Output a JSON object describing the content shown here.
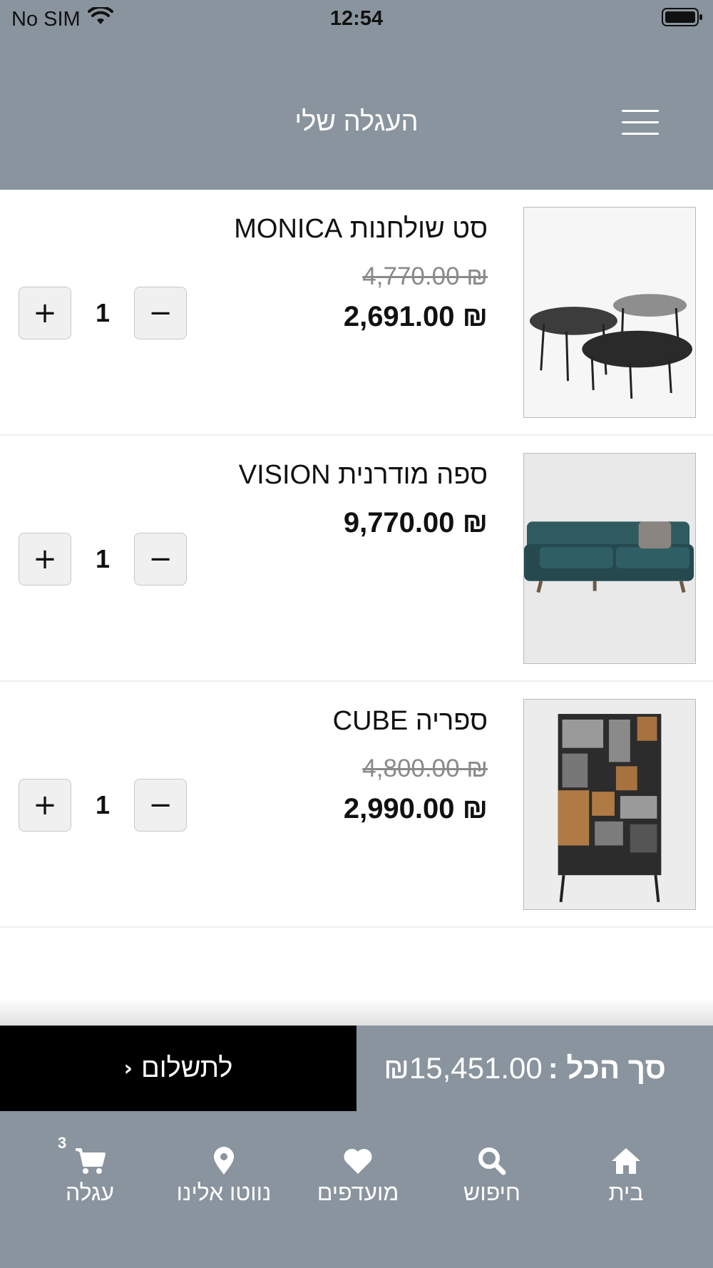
{
  "status_bar": {
    "carrier": "No SIM",
    "time": "12:54"
  },
  "header": {
    "title": "העגלה שלי"
  },
  "cart": {
    "items": [
      {
        "name": "סט שולחנות MONICA",
        "old_price": "₪ 4,770.00",
        "price": "₪ 2,691.00",
        "quantity": "1",
        "image_icon": "coffee-tables-photo"
      },
      {
        "name": "ספה מודרנית VISION",
        "old_price": "",
        "price": "₪ 9,770.00",
        "quantity": "1",
        "image_icon": "sofa-photo"
      },
      {
        "name": "ספריה CUBE",
        "old_price": "₪ 4,800.00",
        "price": "₪ 2,990.00",
        "quantity": "1",
        "image_icon": "bookshelf-photo"
      }
    ],
    "plus_label": "+",
    "minus_label": "−"
  },
  "summary": {
    "total_label": "סך הכל :",
    "total_value": "₪15,451.00",
    "checkout_label": "לתשלום",
    "checkout_chevron": "‹"
  },
  "tabs": [
    {
      "label": "בית",
      "icon": "home-icon"
    },
    {
      "label": "חיפוש",
      "icon": "search-icon"
    },
    {
      "label": "מועדפים",
      "icon": "heart-icon"
    },
    {
      "label": "נווטו אלינו",
      "icon": "location-pin-icon"
    },
    {
      "label": "עגלה",
      "icon": "cart-icon",
      "badge": "3"
    }
  ],
  "colors": {
    "bar": "#8a949e",
    "checkout": "#000000",
    "text": "#111111"
  }
}
